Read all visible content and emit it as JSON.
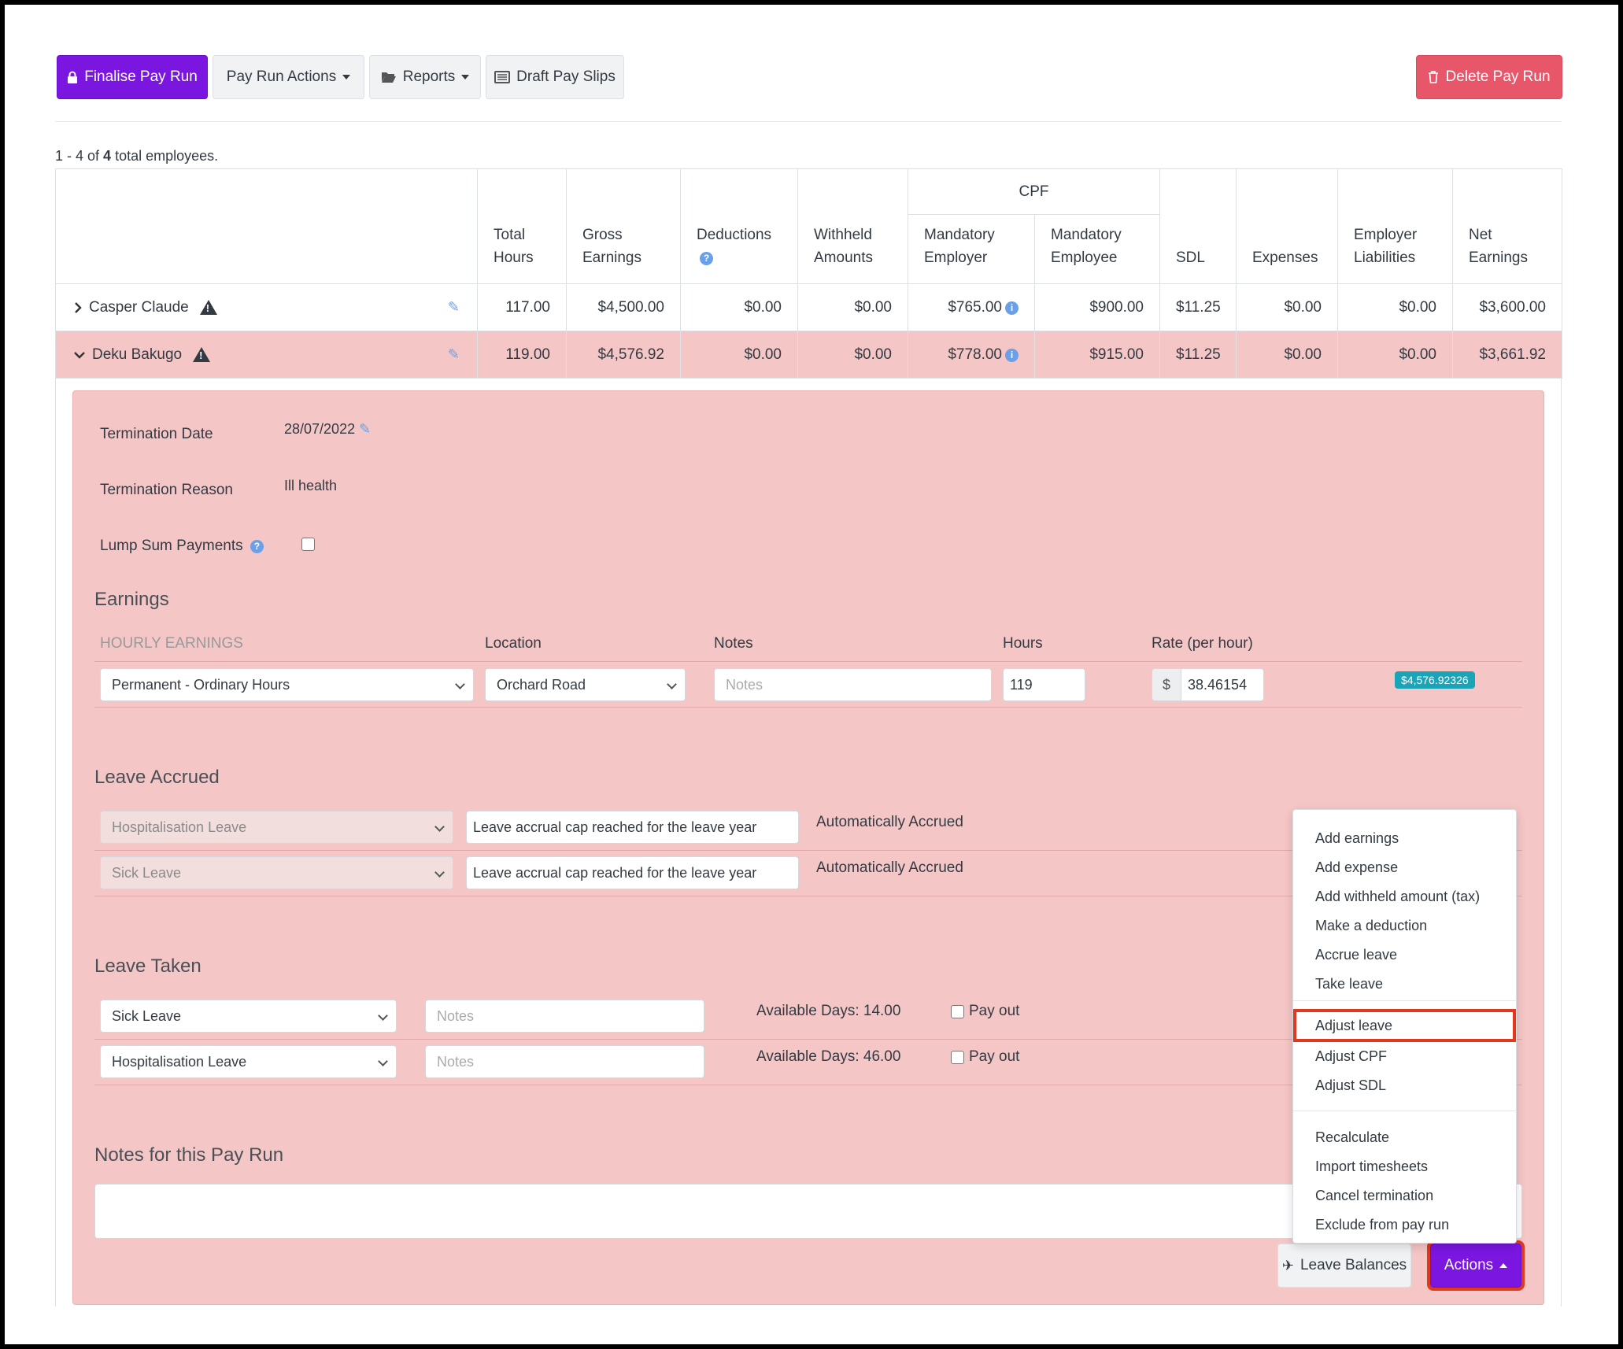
{
  "toolbar": {
    "finalise_label": "Finalise Pay Run",
    "actions_label": "Pay Run Actions",
    "reports_label": "Reports",
    "draft_label": "Draft Pay Slips",
    "delete_label": "Delete Pay Run"
  },
  "summary": {
    "prefix": "1 - 4 of",
    "count": "4",
    "suffix": "total employees."
  },
  "table": {
    "cpf_group": "CPF",
    "headers": {
      "total_hours": [
        "Total",
        "Hours"
      ],
      "gross": [
        "Gross",
        "Earnings"
      ],
      "deductions": "Deductions",
      "withheld": [
        "Withheld",
        "Amounts"
      ],
      "mand_employer": [
        "Mandatory",
        "Employer"
      ],
      "mand_employee": [
        "Mandatory",
        "Employee"
      ],
      "sdl": "SDL",
      "expenses": "Expenses",
      "liabilities": [
        "Employer",
        "Liabilities"
      ],
      "net": [
        "Net",
        "Earnings"
      ]
    },
    "rows": [
      {
        "name": "Casper Claude",
        "total_hours": "117.00",
        "gross": "$4,500.00",
        "deductions": "$0.00",
        "withheld": "$0.00",
        "mand_employer": "$765.00",
        "mand_employee": "$900.00",
        "sdl": "$11.25",
        "expenses": "$0.00",
        "liabilities": "$0.00",
        "net": "$3,600.00"
      },
      {
        "name": "Deku Bakugo",
        "total_hours": "119.00",
        "gross": "$4,576.92",
        "deductions": "$0.00",
        "withheld": "$0.00",
        "mand_employer": "$778.00",
        "mand_employee": "$915.00",
        "sdl": "$11.25",
        "expenses": "$0.00",
        "liabilities": "$0.00",
        "net": "$3,661.92"
      }
    ]
  },
  "detail": {
    "termination_date_label": "Termination Date",
    "termination_date": "28/07/2022",
    "termination_reason_label": "Termination Reason",
    "termination_reason": "Ill health",
    "lump_sum_label": "Lump Sum Payments",
    "earnings_title": "Earnings",
    "earnings_headers": {
      "type": "HOURLY EARNINGS",
      "location": "Location",
      "notes": "Notes",
      "hours": "Hours",
      "rate": "Rate (per hour)"
    },
    "earnings_row": {
      "type": "Permanent - Ordinary Hours",
      "location": "Orchard Road",
      "notes_placeholder": "Notes",
      "hours": "119",
      "currency": "$",
      "rate": "38.46154",
      "total": "$4,576.92326"
    },
    "leave_accrued_title": "Leave Accrued",
    "leave_accrued": [
      {
        "type": "Hospitalisation Leave",
        "message": "Leave accrual cap reached for the leave year",
        "status": "Automatically Accrued"
      },
      {
        "type": "Sick Leave",
        "message": "Leave accrual cap reached for the leave year",
        "status": "Automatically Accrued"
      }
    ],
    "leave_taken_title": "Leave Taken",
    "leave_taken": [
      {
        "type": "Sick Leave",
        "notes_placeholder": "Notes",
        "available": "Available Days: 14.00",
        "payout": "Pay out"
      },
      {
        "type": "Hospitalisation Leave",
        "notes_placeholder": "Notes",
        "available": "Available Days: 46.00",
        "payout": "Pay out"
      }
    ],
    "notes_title": "Notes for this Pay Run"
  },
  "footer": {
    "leave_balances": "Leave Balances",
    "actions": "Actions"
  },
  "menu": {
    "group1": [
      "Add earnings",
      "Add expense",
      "Add withheld amount (tax)",
      "Make a deduction",
      "Accrue leave",
      "Take leave"
    ],
    "group2": [
      "Adjust leave",
      "Adjust CPF",
      "Adjust SDL"
    ],
    "group3": [
      "Recalculate",
      "Import timesheets",
      "Cancel termination",
      "Exclude from pay run"
    ]
  },
  "colors": {
    "accent": "#7b16e0",
    "danger": "#e8566a",
    "selected_row": "#f4c6c6",
    "highlight": "#e0391d"
  }
}
